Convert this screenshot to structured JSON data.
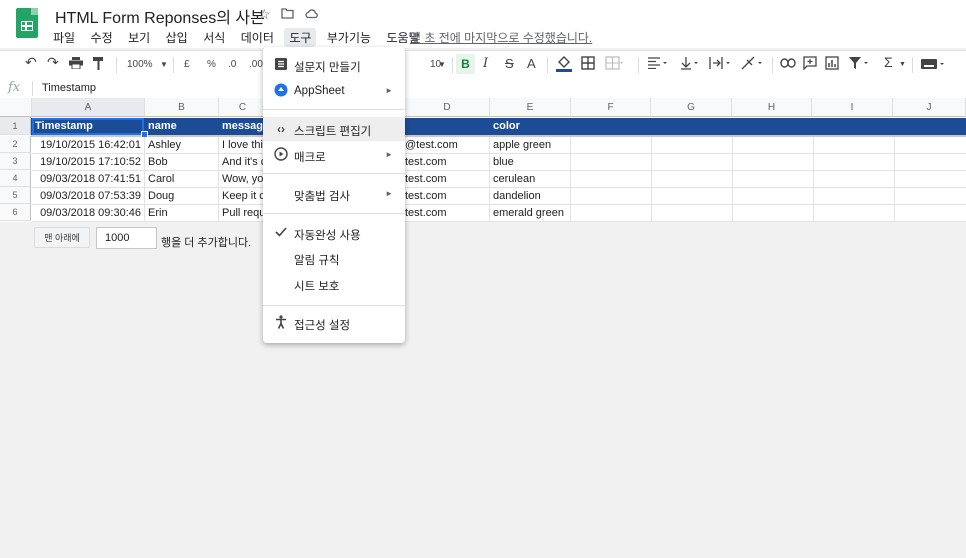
{
  "app": {
    "title": "HTML Form Reponses의 사본",
    "last_edit": "몇 초 전에 마지막으로 수정했습니다."
  },
  "menubar": [
    "파일",
    "수정",
    "보기",
    "삽입",
    "서식",
    "데이터",
    "도구",
    "부가기능",
    "도움말"
  ],
  "toolbar": {
    "zoom": "100%",
    "currency": "£",
    "percent": "%",
    "dec_less": ".0",
    "dec_more": ".00",
    "font_size": "10",
    "bold": "B",
    "italic": "I",
    "strike": "S",
    "text_color": "A",
    "sum": "Σ"
  },
  "formula_bar": {
    "fx": "fx",
    "value": "Timestamp"
  },
  "columns": [
    "A",
    "B",
    "C",
    "D",
    "E",
    "F",
    "G",
    "H",
    "I",
    "J"
  ],
  "rows": [
    "1",
    "2",
    "3",
    "4",
    "5",
    "6"
  ],
  "sheet": {
    "header": [
      "Timestamp",
      "name",
      "message",
      "",
      "color"
    ],
    "data": [
      [
        "19/10/2015 16:42:01",
        "Ashley",
        "I love this",
        "@test.com",
        "apple green"
      ],
      [
        "19/10/2015 17:10:52",
        "Bob",
        "And it's c",
        "test.com",
        "blue"
      ],
      [
        "09/03/2018 07:41:51",
        "Carol",
        "Wow, yo",
        "test.com",
        "cerulean"
      ],
      [
        "09/03/2018 07:53:39",
        "Doug",
        "Keep it c",
        "test.com",
        "dandelion"
      ],
      [
        "09/03/2018 09:30:46",
        "Erin",
        "Pull requ",
        "test.com",
        "emerald green"
      ]
    ],
    "header_color": "#1d4c97"
  },
  "add_rows": {
    "button": "맨 아래에",
    "count": "1000",
    "suffix": "행을 더 추가합니다."
  },
  "tools_menu": {
    "items": [
      {
        "label": "설문지 만들기",
        "icon": "form-icon"
      },
      {
        "label": "AppSheet",
        "icon": "appsheet-icon",
        "arrow": "►"
      },
      {
        "label": "스크립트 편집기",
        "icon": "code-icon"
      },
      {
        "label": "매크로",
        "icon": "play-icon",
        "arrow": "►"
      },
      {
        "label": "맞춤법 검사",
        "arrow": "►"
      },
      {
        "label": "자동완성 사용",
        "icon": "check-icon"
      },
      {
        "label": "알림 규칙"
      },
      {
        "label": "시트 보호"
      },
      {
        "label": "접근성 설정",
        "icon": "accessibility-icon"
      }
    ]
  }
}
